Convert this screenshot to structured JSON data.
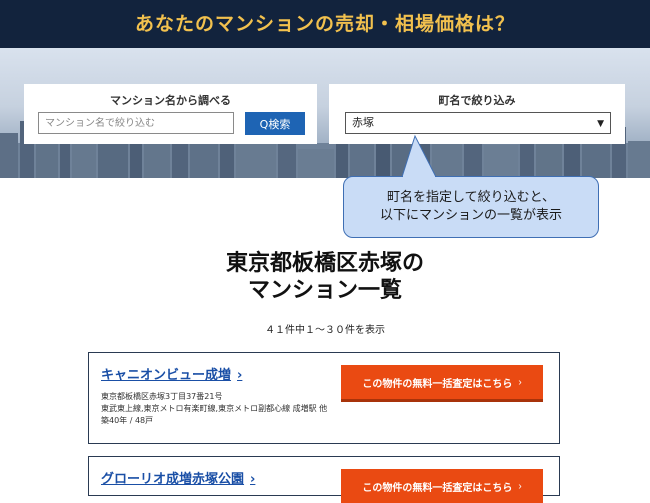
{
  "header": {
    "title": "あなたのマンションの売却・相場価格は？"
  },
  "search": {
    "label": "マンション名から調べる",
    "placeholder": "マンション名で絞り込む",
    "button_label": "Q検索"
  },
  "filter": {
    "label": "町名で絞り込み",
    "selected": "赤塚"
  },
  "tooltip": {
    "line1": "町名を指定して絞り込むと、",
    "line2": "以下にマンションの一覧が表示"
  },
  "page": {
    "title_line1": "東京都板橋区赤塚の",
    "title_line2": "マンション一覧",
    "result_count": "４１件中１～３０件を表示"
  },
  "listings": [
    {
      "name": "キャニオンビュー成増",
      "address": "東京都板橋区赤塚3丁目37番21号",
      "access": "東武東上線,東京メトロ有楽町線,東京メトロ副都心線 成増駅 他",
      "age_units": "築40年 / 48戸",
      "cta_label": "この物件の無料一括査定はこちら"
    },
    {
      "name": "グローリオ成増赤塚公園",
      "cta_label": "この物件の無料一括査定はこちら"
    }
  ],
  "colors": {
    "header_bg": "#12233d",
    "header_text": "#f2c14e",
    "search_button": "#1e64b4",
    "cta": "#ea4a12",
    "link": "#1a4fa6",
    "tooltip_bg": "#c9dcf6"
  }
}
